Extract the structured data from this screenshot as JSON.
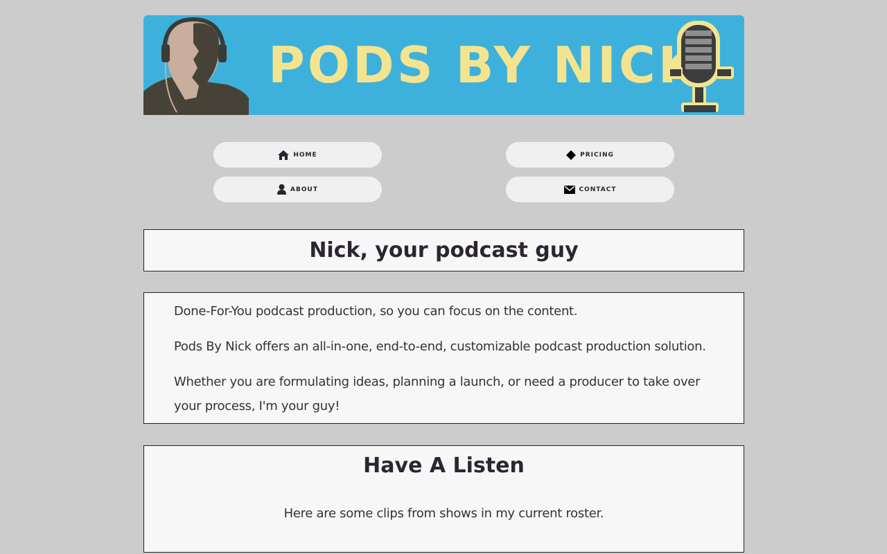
{
  "banner": {
    "title": "PODS BY NICK",
    "bg_color": "#3db1dc",
    "title_color": "#f4e48f"
  },
  "nav": [
    {
      "label": "HOME",
      "icon": "home-icon"
    },
    {
      "label": "PRICING",
      "icon": "diamond-icon"
    },
    {
      "label": "ABOUT",
      "icon": "user-icon"
    },
    {
      "label": "CONTACT",
      "icon": "envelope-icon"
    }
  ],
  "hero": {
    "title": "Nick, your podcast guy"
  },
  "intro": {
    "paragraphs": [
      "Done-For-You podcast production, so you can focus on the content.",
      "Pods By Nick offers an all-in-one, end-to-end, customizable podcast production solution.",
      "Whether you are formulating ideas, planning a launch, or need a producer to take over your process, I'm your guy!"
    ]
  },
  "listen": {
    "title": "Have A Listen",
    "text": "Here are some clips from shows in my current roster."
  }
}
